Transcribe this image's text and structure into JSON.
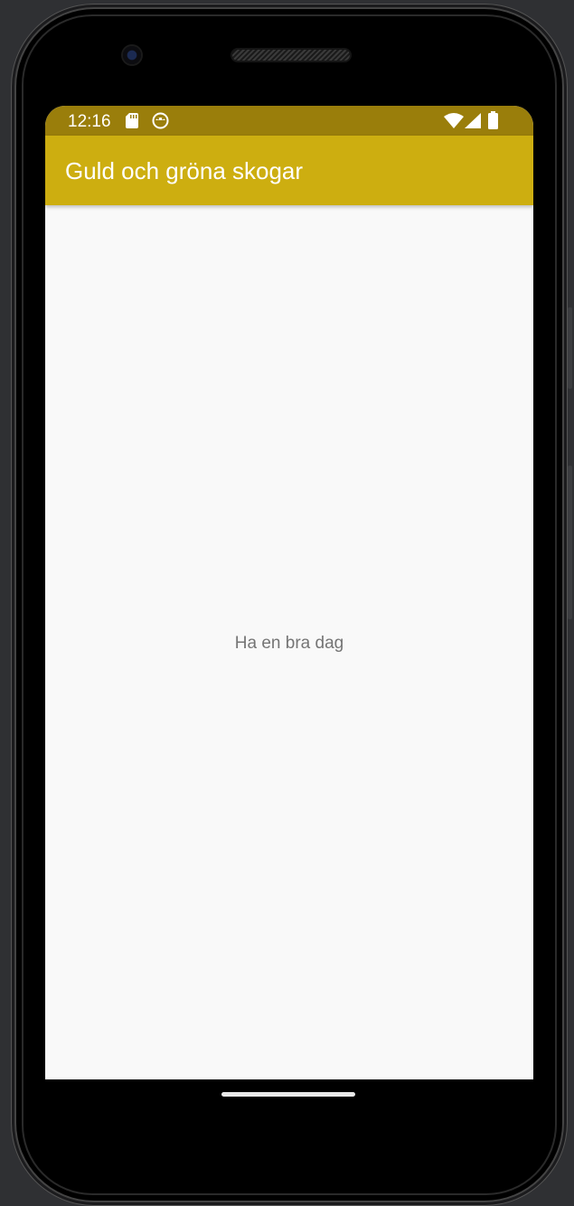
{
  "status_bar": {
    "time": "12:16",
    "icons": [
      "sd-card-icon",
      "android-debug-icon",
      "wifi-icon",
      "signal-icon",
      "battery-icon"
    ],
    "color": "#9a7e0b"
  },
  "app_bar": {
    "title": "Guld och gröna skogar",
    "color": "#cdae10"
  },
  "content": {
    "message": "Ha en bra dag",
    "background": "#f9f9f9"
  }
}
